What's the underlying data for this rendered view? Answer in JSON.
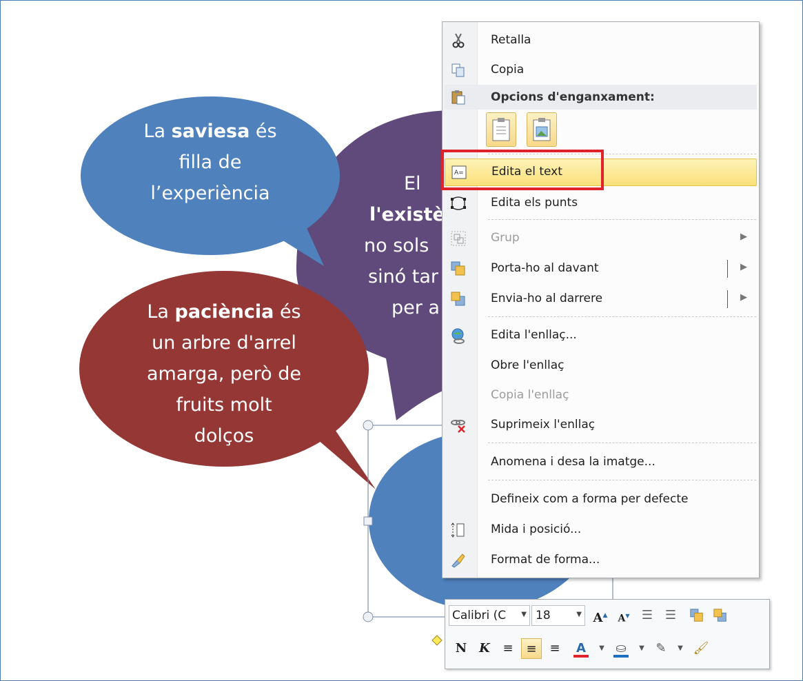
{
  "bubbles": {
    "saviesa": {
      "pre": "La ",
      "bold": "saviesa",
      "post": " és",
      "line2": "filla de",
      "line3": "l’experiència",
      "color": "#4f81bd"
    },
    "existencia": {
      "line1": "El",
      "bold": "l'existè",
      "line3": "no sols",
      "line4": "sinó tar",
      "line5": "per a",
      "color": "#604a7b"
    },
    "paciencia": {
      "pre": "La ",
      "bold": "paciència",
      "post": " és",
      "line2": "un arbre d'arrel",
      "line3": "amarga, però de",
      "line4": "fruits molt",
      "line5": "dolços",
      "color": "#953735"
    },
    "selected": {
      "color": "#4f81bd"
    }
  },
  "context_menu": {
    "items": [
      {
        "label": "Retalla",
        "icon": "scissors-icon"
      },
      {
        "label": "Copia",
        "icon": "copy-icon"
      },
      {
        "label": "Opcions d'enganxament:",
        "icon": "paste-icon"
      },
      {
        "label": "Edita el text",
        "icon": "edit-text-icon"
      },
      {
        "label": "Edita els punts",
        "icon": "edit-points-icon"
      },
      {
        "label": "Grup",
        "icon": "group-icon"
      },
      {
        "label": "Porta-ho al davant",
        "icon": "bring-front-icon"
      },
      {
        "label": "Envia-ho al darrere",
        "icon": "send-back-icon"
      },
      {
        "label": "Edita l'enllaç...",
        "icon": "hyperlink-icon"
      },
      {
        "label": "Obre l'enllaç"
      },
      {
        "label": "Copia l'enllaç"
      },
      {
        "label": "Suprimeix l'enllaç",
        "icon": "remove-link-icon"
      },
      {
        "label": "Anomena i desa la imatge..."
      },
      {
        "label": "Defineix com a forma per defecte"
      },
      {
        "label": "Mida i posició...",
        "icon": "size-position-icon"
      },
      {
        "label": "Format de forma...",
        "icon": "format-shape-icon"
      }
    ],
    "highlight_color": "#e0222a"
  },
  "mini_toolbar": {
    "font": "Calibri (C",
    "size": "18",
    "bold": "N",
    "italic": "K",
    "font_color": "#e0222a",
    "fill_color": "#1f6fc0"
  }
}
